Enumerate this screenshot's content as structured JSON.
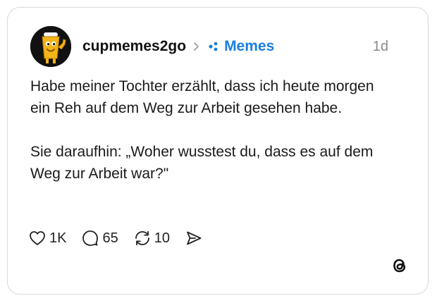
{
  "post": {
    "username": "cupmemes2go",
    "community": "Memes",
    "time": "1d",
    "paragraphs": [
      "Habe meiner Tochter erzählt, dass ich heute morgen ein Reh auf dem Weg zur Arbeit gesehen habe.",
      "Sie daraufhin: „Woher wusstest du, dass es auf dem Weg zur Arbeit war?\""
    ]
  },
  "actions": {
    "likes": "1K",
    "replies": "65",
    "reposts": "10"
  },
  "icons": {
    "like": "heart-icon",
    "reply": "speech-bubble-icon",
    "repost": "repost-arrows-icon",
    "share": "send-icon",
    "chevron": "chevron-right-icon",
    "community": "community-dots-icon",
    "brand": "threads-logo-icon"
  },
  "colors": {
    "community_accent": "#1a7ee0",
    "avatar_bg": "#111111",
    "avatar_cup": "#f2b418"
  }
}
